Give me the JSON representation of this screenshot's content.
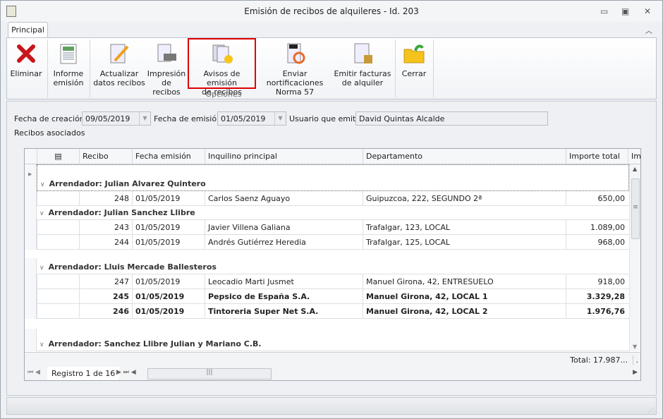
{
  "window": {
    "title": "Emisión de recibos de alquileres - Id. 203",
    "minimize": "▭",
    "restore": "▣",
    "close": "✕"
  },
  "ribbon": {
    "tab": "Principal",
    "group_label": "Opciones",
    "buttons": [
      {
        "label1": "Eliminar",
        "label2": ""
      },
      {
        "label1": "Informe",
        "label2": "emisión"
      },
      {
        "label1": "Actualizar",
        "label2": "datos recibos"
      },
      {
        "label1": "Impresión",
        "label2": "de recibos"
      },
      {
        "label1": "Avisos de emisión",
        "label2": "de recibos"
      },
      {
        "label1": "Enviar nortificaciones",
        "label2": "Norma 57"
      },
      {
        "label1": "Emitir facturas",
        "label2": "de alquiler"
      },
      {
        "label1": "Cerrar",
        "label2": ""
      }
    ]
  },
  "form": {
    "fecha_creacion_label": "Fecha de creación:",
    "fecha_creacion": "09/05/2019",
    "fecha_emision_label": "Fecha de emisión:",
    "fecha_emision": "01/05/2019",
    "usuario_label": "Usuario que emite:",
    "usuario": "David Quintas Alcalde",
    "recibos_label": "Recibos asociados"
  },
  "grid": {
    "columns": [
      "Recibo",
      "Fecha emisión",
      "Inquilino principal",
      "Departamento",
      "Importe total",
      "Imp"
    ],
    "groups": [
      {
        "title": "Arrendador: Julian Alvarez Quintero",
        "rows": [
          {
            "recibo": "248",
            "fecha": "01/05/2019",
            "inquilino": "Carlos Saenz Aguayo",
            "depto": "Guipuzcoa, 222, SEGUNDO 2ª",
            "importe": "650,00",
            "bold": false
          }
        ]
      },
      {
        "title": "Arrendador: Julian Sanchez Llibre",
        "rows": [
          {
            "recibo": "243",
            "fecha": "01/05/2019",
            "inquilino": "Javier Villena Galiana",
            "depto": "Trafalgar, 123, LOCAL",
            "importe": "1.089,00",
            "bold": false
          },
          {
            "recibo": "244",
            "fecha": "01/05/2019",
            "inquilino": "Andrés Gutiérrez Heredia",
            "depto": "Trafalgar, 125, LOCAL",
            "importe": "968,00",
            "bold": false
          }
        ]
      },
      {
        "title": "Arrendador: Lluis Mercade Ballesteros",
        "rows": [
          {
            "recibo": "247",
            "fecha": "01/05/2019",
            "inquilino": "Leocadio Marti Jusmet",
            "depto": "Manuel Girona, 42, ENTRESUELO",
            "importe": "918,00",
            "bold": false
          },
          {
            "recibo": "245",
            "fecha": "01/05/2019",
            "inquilino": "Pepsico de España S.A.",
            "depto": "Manuel Girona, 42, LOCAL 1",
            "importe": "3.329,28",
            "bold": true
          },
          {
            "recibo": "246",
            "fecha": "01/05/2019",
            "inquilino": "Tintoreria Super Net S.A.",
            "depto": "Manuel Girona, 42, LOCAL 2",
            "importe": "1.976,76",
            "bold": true
          }
        ]
      },
      {
        "title": "Arrendador: Sanchez Llibre Julian y Mariano C.B.",
        "rows": []
      }
    ],
    "total": "Total: 17.987...",
    "total_extra": ".",
    "navigator": "Registro 1 de 16"
  }
}
